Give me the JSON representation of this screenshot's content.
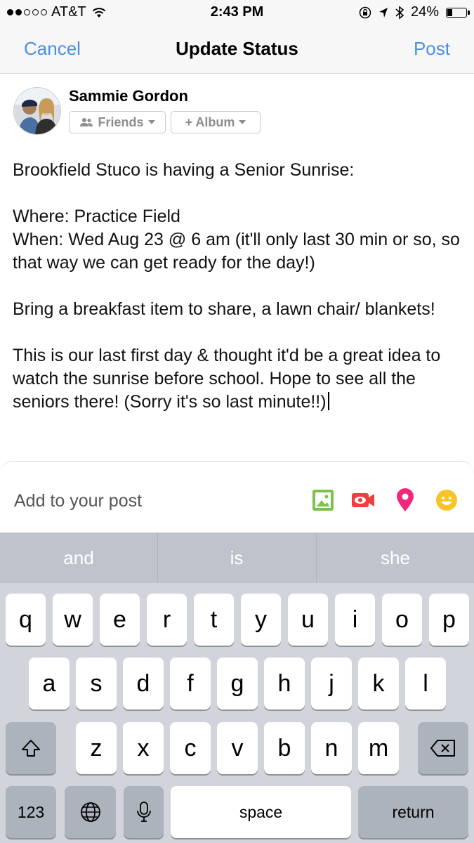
{
  "status_bar": {
    "carrier": "AT&T",
    "time": "2:43 PM",
    "battery": "24%",
    "battery_level": 0.24
  },
  "nav": {
    "cancel": "Cancel",
    "title": "Update Status",
    "post": "Post"
  },
  "composer": {
    "user_name": "Sammie Gordon",
    "audience_label": "Friends",
    "album_label": "+ Album",
    "post_text": "Brookfield Stuco is having a Senior Sunrise:\n\nWhere: Practice Field\nWhen: Wed Aug 23 @ 6 am (it'll only last 30 min or so, so that way we can get ready for the day!)\n\nBring a breakfast item to share, a lawn chair/ blankets!\n\nThis is our last first day & thought it'd be a great idea to watch the sunrise before school. Hope to see all the seniors there! (Sorry it's so last minute!!)"
  },
  "add_to_post": {
    "label": "Add to your post",
    "icons": [
      "photo-icon",
      "video-icon",
      "location-icon",
      "emoji-icon"
    ],
    "colors": {
      "photo": "#7cc24a",
      "video": "#f03e3e",
      "location": "#f0287a",
      "emoji": "#f7c32b"
    }
  },
  "keyboard": {
    "suggestions": [
      "and",
      "is",
      "she"
    ],
    "row1": [
      "q",
      "w",
      "e",
      "r",
      "t",
      "y",
      "u",
      "i",
      "o",
      "p"
    ],
    "row2": [
      "a",
      "s",
      "d",
      "f",
      "g",
      "h",
      "j",
      "k",
      "l"
    ],
    "row3": [
      "z",
      "x",
      "c",
      "v",
      "b",
      "n",
      "m"
    ],
    "numbers": "123",
    "space": "space",
    "return": "return"
  },
  "colors": {
    "accent": "#4a90e2"
  }
}
